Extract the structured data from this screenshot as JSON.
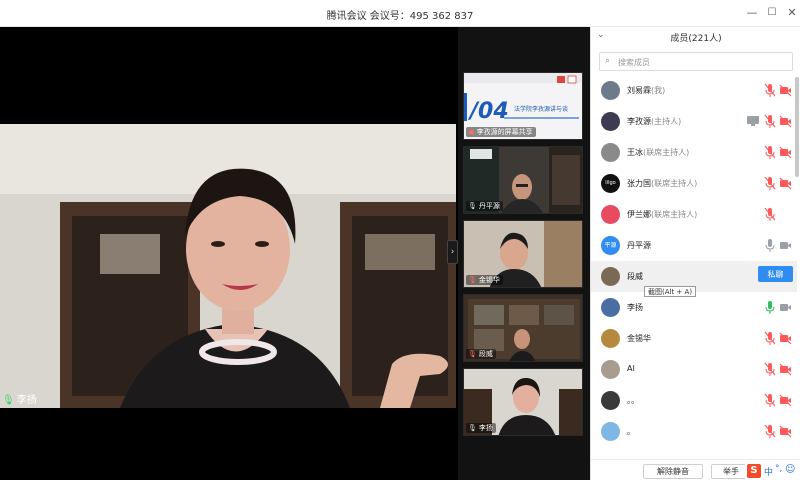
{
  "window": {
    "title": "腾讯会议 会议号：495 362 837",
    "minimize_glyph": "—",
    "maximize_glyph": "☐",
    "close_glyph": "✕"
  },
  "main_video": {
    "speaker_name": "李扬",
    "mic_icon": "mic-on-icon"
  },
  "thumbnails": [
    {
      "name": "李孜源的屏幕共享",
      "slide_number": "/04",
      "slide_text": "法学院李孜源讲与谈",
      "type": "screen-share"
    },
    {
      "name": "丹平源",
      "mic": "on"
    },
    {
      "name": "金锡华",
      "mic": "muted"
    },
    {
      "name": "段威",
      "mic": "muted"
    },
    {
      "name": "李扬",
      "mic": "on"
    }
  ],
  "panel": {
    "collapse_glyph": "⌄",
    "title": "成员(221人)",
    "search_placeholder": "搜索成员",
    "tooltip": "截图(Alt + A)",
    "mute_button": "私聊",
    "footer": {
      "unmute_all": "解除静音",
      "raise_hand": "举手"
    },
    "ime": {
      "logo": "S",
      "mode": "中",
      "punct": "°,",
      "emoji": "☺"
    }
  },
  "members": [
    {
      "name": "刘易霖",
      "role": "(我)",
      "mic": "muted",
      "cam": "off",
      "avatar_color": "#6c7a89"
    },
    {
      "name": "李孜源",
      "role": "(主持人)",
      "mic": "muted",
      "cam": "off",
      "sharing": true,
      "avatar_color": "#3c3b52"
    },
    {
      "name": "王冰",
      "role": "(联席主持人)",
      "mic": "muted",
      "cam": "off",
      "avatar_color": "#8a8a8a"
    },
    {
      "name": "张力国",
      "role": "(联席主持人)",
      "mic": "muted",
      "cam": "off",
      "avatar_color": "#111111",
      "avatar_text": "lilgo"
    },
    {
      "name": "伊兰娜",
      "role": "(联席主持人)",
      "mic": "muted",
      "cam": "none",
      "avatar_color": "#e84a5f"
    },
    {
      "name": "丹平源",
      "role": "",
      "mic": "idle",
      "cam": "on",
      "avatar_color": "#2f8cf2",
      "avatar_text": "平源"
    },
    {
      "name": "段威",
      "role": "",
      "mic": "none",
      "cam": "none",
      "avatar_color": "#7a6a55",
      "highlight": true
    },
    {
      "name": "李扬",
      "role": "",
      "mic": "active",
      "cam": "on",
      "avatar_color": "#4a6da3"
    },
    {
      "name": "金锡华",
      "role": "",
      "mic": "muted",
      "cam": "off",
      "avatar_color": "#b68a3e"
    },
    {
      "name": "AI",
      "role": "",
      "mic": "muted",
      "cam": "off",
      "avatar_color": "#a89c8f"
    },
    {
      "name": "。。",
      "role": "",
      "mic": "muted",
      "cam": "off",
      "avatar_color": "#3a3a3a"
    },
    {
      "name": "。",
      "role": "",
      "mic": "muted",
      "cam": "off",
      "avatar_color": "#7fb6e3"
    }
  ],
  "colors": {
    "accent": "#2f8cf2",
    "muted_red": "#ff5a5a",
    "active_green": "#2fbf5b"
  }
}
